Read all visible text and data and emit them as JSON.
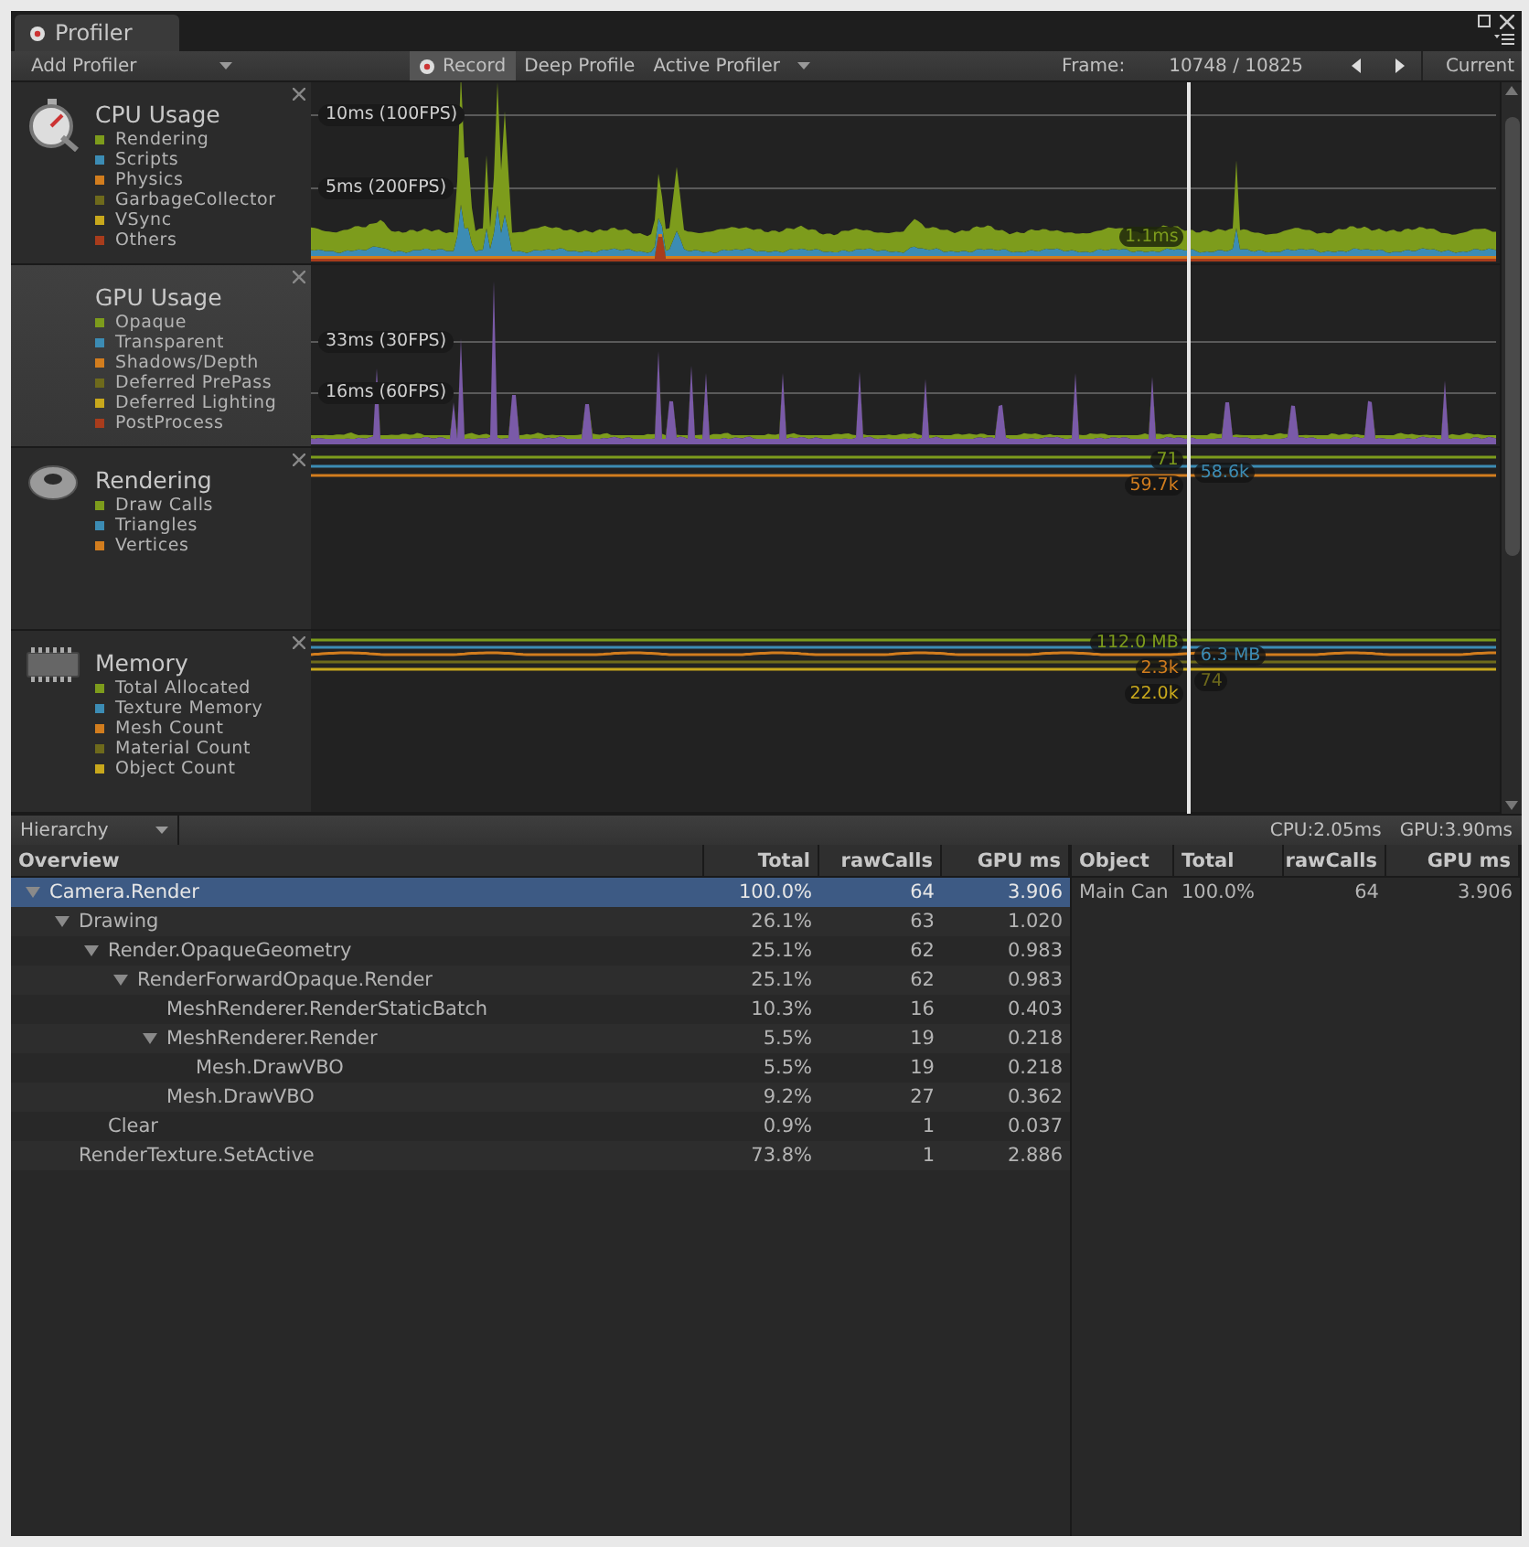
{
  "window": {
    "title": "Profiler"
  },
  "toolbar": {
    "add_profiler": "Add Profiler",
    "record": {
      "label": "Record",
      "on": true
    },
    "deep_profile": {
      "label": "Deep Profile",
      "on": false
    },
    "active_profiler": "Active Profiler",
    "frame_label": "Frame:",
    "frame": "10748 / 10825",
    "current": "Current"
  },
  "timeline": {
    "level": 0.739
  },
  "modules": [
    {
      "kind": "cpu",
      "title": "CPU Usage",
      "selected": false,
      "legend": [
        {
          "label": "Rendering",
          "color": "#7d9c1c"
        },
        {
          "label": "Scripts",
          "color": "#3c8cb4"
        },
        {
          "label": "Physics",
          "color": "#d27d1e"
        },
        {
          "label": "GarbageCollector",
          "color": "#6e6a1c"
        },
        {
          "label": "VSync",
          "color": "#c8a81c"
        },
        {
          "label": "Others",
          "color": "#a83c1c"
        }
      ],
      "thresholds": [
        "10ms (100FPS)",
        "5ms (200FPS)"
      ],
      "readings": [
        "1.1ms"
      ]
    },
    {
      "kind": "gpu",
      "title": "GPU Usage",
      "selected": true,
      "legend": [
        {
          "label": "Opaque",
          "color": "#7d9c1c"
        },
        {
          "label": "Transparent",
          "color": "#3c8cb4"
        },
        {
          "label": "Shadows/Depth",
          "color": "#d27d1e"
        },
        {
          "label": "Deferred PrePass",
          "color": "#6e6a1c"
        },
        {
          "label": "Deferred Lighting",
          "color": "#c8a81c"
        },
        {
          "label": "PostProcess",
          "color": "#a83c1c"
        }
      ],
      "thresholds": [
        "33ms (30FPS)",
        "16ms (60FPS)"
      ]
    },
    {
      "kind": "rendering",
      "title": "Rendering",
      "selected": false,
      "legend": [
        {
          "label": "Draw Calls",
          "color": "#7d9c1c"
        },
        {
          "label": "Triangles",
          "color": "#3c8cb4"
        },
        {
          "label": "Vertices",
          "color": "#d27d1e"
        }
      ],
      "readings": [
        "71",
        "58.6k",
        "59.7k"
      ]
    },
    {
      "kind": "memory",
      "title": "Memory",
      "selected": false,
      "legend": [
        {
          "label": "Total Allocated",
          "color": "#7d9c1c"
        },
        {
          "label": "Texture Memory",
          "color": "#3c8cb4"
        },
        {
          "label": "Mesh Count",
          "color": "#d27d1e"
        },
        {
          "label": "Material Count",
          "color": "#6e6a1c"
        },
        {
          "label": "Object Count",
          "color": "#c8a81c"
        }
      ],
      "readings": [
        "112.0 MB",
        "6.3 MB",
        "2.3k",
        "74",
        "22.0k"
      ]
    }
  ],
  "hierarchy": {
    "view": "Hierarchy",
    "cpu": "CPU:2.05ms",
    "gpu": "GPU:3.90ms",
    "columns": [
      "Overview",
      "Total",
      "rawCalls",
      "GPU ms"
    ],
    "rows": [
      {
        "name": "Camera.Render",
        "total": "100.0%",
        "draw_calls": "64",
        "gpu_ms": "3.906",
        "selected": true,
        "expanded": true,
        "children": [
          {
            "name": "Drawing",
            "total": "26.1%",
            "draw_calls": "63",
            "gpu_ms": "1.020",
            "selected": false,
            "expanded": true,
            "children": [
              {
                "name": "Render.OpaqueGeometry",
                "total": "25.1%",
                "draw_calls": "62",
                "gpu_ms": "0.983",
                "selected": false,
                "expanded": true,
                "children": [
                  {
                    "name": "RenderForwardOpaque.Render",
                    "total": "25.1%",
                    "draw_calls": "62",
                    "gpu_ms": "0.983",
                    "selected": false,
                    "expanded": true,
                    "children": [
                      {
                        "name": "MeshRenderer.RenderStaticBatch",
                        "total": "10.3%",
                        "draw_calls": "16",
                        "gpu_ms": "0.403",
                        "selected": false
                      },
                      {
                        "name": "MeshRenderer.Render",
                        "total": "5.5%",
                        "draw_calls": "19",
                        "gpu_ms": "0.218",
                        "selected": false,
                        "expanded": true,
                        "children": [
                          {
                            "name": "Mesh.DrawVBO",
                            "total": "5.5%",
                            "draw_calls": "19",
                            "gpu_ms": "0.218",
                            "selected": false
                          }
                        ]
                      },
                      {
                        "name": "Mesh.DrawVBO",
                        "total": "9.2%",
                        "draw_calls": "27",
                        "gpu_ms": "0.362",
                        "selected": false
                      }
                    ]
                  }
                ]
              },
              {
                "name": "Clear",
                "total": "0.9%",
                "draw_calls": "1",
                "gpu_ms": "0.037",
                "selected": false
              }
            ]
          },
          {
            "name": "RenderTexture.SetActive",
            "total": "73.8%",
            "draw_calls": "1",
            "gpu_ms": "2.886",
            "selected": false
          }
        ]
      }
    ],
    "details": {
      "columns": [
        "Object",
        "Total",
        "rawCalls",
        "GPU ms"
      ],
      "rows": [
        {
          "object": "Main Can",
          "total": "100.0%",
          "draw_calls": "64",
          "gpu_ms": "3.906"
        }
      ]
    }
  }
}
